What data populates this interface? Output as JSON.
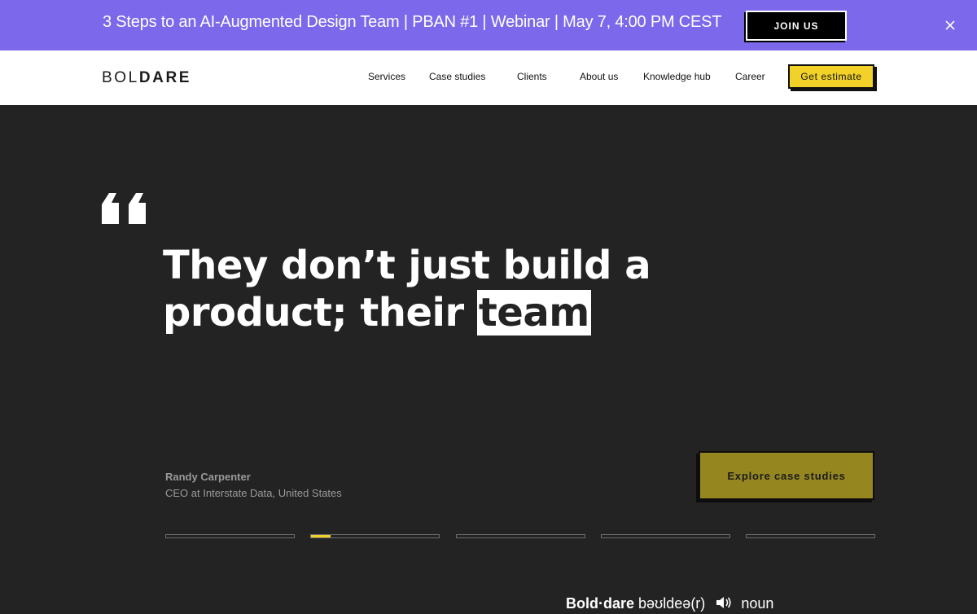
{
  "announcement": {
    "text": "3 Steps to an AI-Augmented Design Team | PBAN #1 | Webinar | May 7, 4:00 PM CEST",
    "button_label": "JOIN US",
    "close_icon": "close-icon"
  },
  "header": {
    "logo_light": "BOL",
    "logo_bold": "DARE",
    "nav": [
      "Services",
      "Case studies",
      "Clients",
      "About us",
      "Knowledge hub",
      "Career"
    ],
    "cta_label": "Get estimate"
  },
  "hero": {
    "quote_icon": "quote-icon",
    "quote_line1": "They don’t just build a",
    "quote_line2_start": "product; their ",
    "quote_highlight": "team",
    "author_name": "Randy Carpenter",
    "author_role": "CEO at Interstate Data, United States",
    "cta_label": "Explore case studies",
    "slides_total": 5,
    "active_slide": 2,
    "active_slide_progress": 0.15
  },
  "definition": {
    "word": "Bold·dare",
    "phonetic": "bəʊldeə(r)",
    "speaker_icon": "speaker-icon",
    "part_of_speech": "noun"
  },
  "colors": {
    "announcement_bg": "#7b68ea",
    "accent_yellow": "#f2d229",
    "hero_bg": "#232323",
    "explore_btn": "#958620"
  }
}
